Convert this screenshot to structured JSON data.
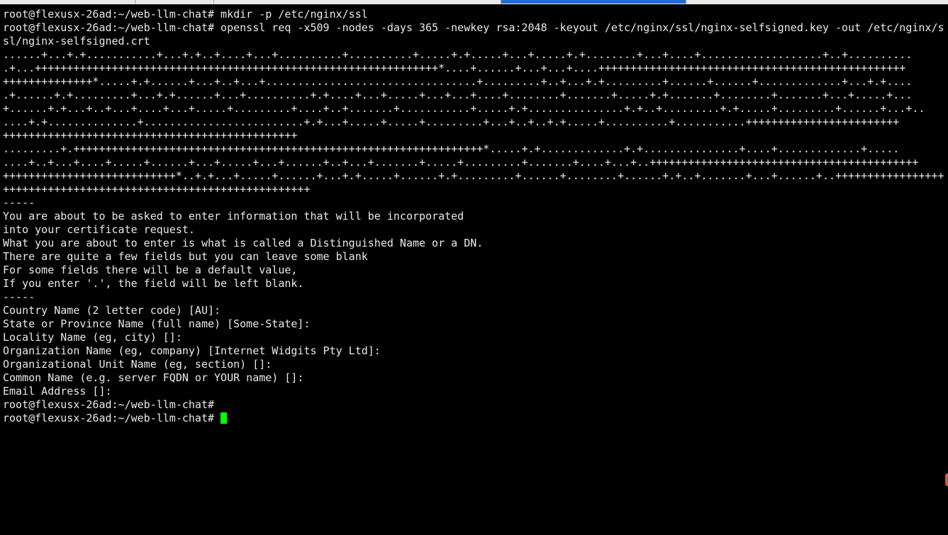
{
  "terminal": {
    "prompt": "root@flexusx-26ad:~/web-llm-chat#",
    "lines": [
      "root@flexusx-26ad:~/web-llm-chat# mkdir -p /etc/nginx/ssl",
      "root@flexusx-26ad:~/web-llm-chat# openssl req -x509 -nodes -days 365 -newkey rsa:2048 -keyout /etc/nginx/ssl/nginx-selfsigned.key -out /etc/nginx/s",
      "sl/nginx-selfsigned.crt",
      "......+...+.+...........+...+.+..+....+...+..........+..........+.....+.+.....+...+.....+.+........+...+....+...................+..+..........",
      ".+...+++++++++++++++++++++++++++++++++++++++++++++++++++++++++++++++*....+......+...+...+....++++++++++++++++++++++++++++++++++++++++++++++++",
      "++++++++++++++*.....+.+......+...+..+...+.................................+.........+..+...+.+.........+......+......+.............+...+.+....",
      ".+......+.+.........+...+.+......+...+..........+.+....+...+.....+...+...+....+........+.......+.....+.+.......+........+.......+...+.....+...",
      "+......+.+...+..+...+....+...+.....+.........+....+..+.......+...........+.....+.+...............+.+..+.........+.+.....+.........+......+...+..",
      "....+.+..............+.........................+.+...+.....+.....+.........+...+..+..+.+.....+..........+...........++++++++++++++++++++++++",
      "++++++++++++++++++++++++++++++++++++++++++++++",
      ".........+.++++++++++++++++++++++++++++++++++++++++++++++++++++++++++++++++*.....+.+.............+.+...............+....+.............+.....",
      "....+..+...+....+.....+......+...+.....+...+......+..+...+.......+.....+.........+.......+....+...+..++++++++++++++++++++++++++++++++++++++++++",
      "+++++++++++++++++++++++++++*..+.+...+.....+......+...+.+.....+......+.+.........+......+........+......+.+..+.......+...+......+..+++++++++++++++++",
      "++++++++++++++++++++++++++++++++++++++++++++++++",
      "-----",
      "You are about to be asked to enter information that will be incorporated",
      "into your certificate request.",
      "What you are about to enter is what is called a Distinguished Name or a DN.",
      "There are quite a few fields but you can leave some blank",
      "For some fields there will be a default value,",
      "If you enter '.', the field will be left blank.",
      "-----",
      "Country Name (2 letter code) [AU]:",
      "State or Province Name (full name) [Some-State]:",
      "Locality Name (eg, city) []:",
      "Organization Name (eg, company) [Internet Widgits Pty Ltd]:",
      "Organizational Unit Name (eg, section) []:",
      "Common Name (e.g. server FQDN or YOUR name) []:",
      "Email Address []:",
      "root@flexusx-26ad:~/web-llm-chat#"
    ],
    "cursor_color": "#00ff00",
    "background": "#000000",
    "foreground": "#e9e9e9"
  }
}
